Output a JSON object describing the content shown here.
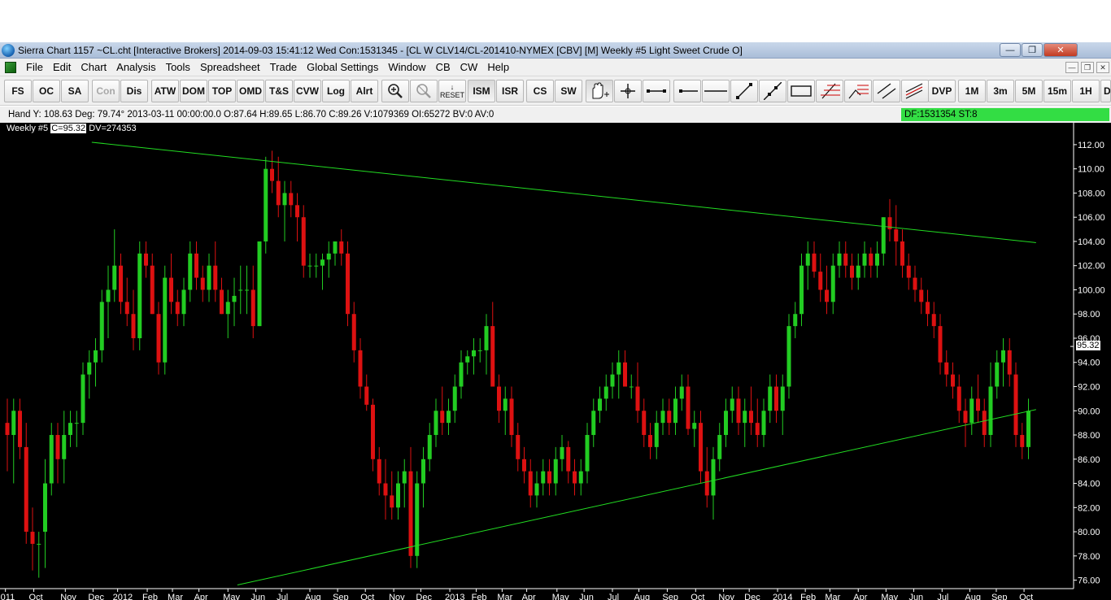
{
  "window": {
    "title": "Sierra Chart 1157 ~CL.cht [Interactive Brokers] 2014-09-03  15:41:12 Wed  Con:1531345 - [CL W  CLV14/CL-201410-NYMEX [CBV] [M]  Weekly  #5  Light Sweet Crude O]",
    "minimize": "—",
    "maximize": "❐",
    "close": "✕"
  },
  "menu": {
    "items": [
      "File",
      "Edit",
      "Chart",
      "Analysis",
      "Tools",
      "Spreadsheet",
      "Trade",
      "Global Settings",
      "Window",
      "CB",
      "CW",
      "Help"
    ],
    "mdi_minimize": "—",
    "mdi_restore": "❐",
    "mdi_close": "✕"
  },
  "toolbar": {
    "buttons": [
      "FS",
      "OC",
      "SA",
      "Con",
      "Dis",
      "ATW",
      "DOM",
      "TOP",
      "OMD",
      "T&S",
      "CVW",
      "Log",
      "Alrt"
    ],
    "reset": "RESET",
    "buttons2": [
      "ISM",
      "ISR",
      "CS",
      "SW"
    ],
    "tools": [
      "hand-tool-icon",
      "crosshair-icon",
      "ruler-icon",
      "ray-icon",
      "horizontal-line-icon",
      "line-icon",
      "extended-line-icon",
      "rectangle-icon",
      "fib-icon",
      "fib-extension-icon",
      "parallel-lines-icon",
      "regression-icon"
    ],
    "buttons3": [
      "DVP",
      "1M",
      "3m",
      "5M",
      "15m",
      "1H",
      "D"
    ]
  },
  "status": {
    "text": "Hand Y: 108.63  Deg: 79.74°  2013-03-11  00:00:00.0  O:87.64  H:89.65  L:86.70  C:89.26  V:1079369  OI:65272  BV:0  AV:0",
    "df": "DF:1531354  ST:8"
  },
  "chart_header": {
    "study": "Weekly #5",
    "close_label": "C=95.32",
    "dv": "DV=274353"
  },
  "price_label": "95.32",
  "colors": {
    "up": "#22cc22",
    "down": "#dd1111",
    "trendline": "#22dd22",
    "background": "#000000",
    "axis_text": "#ffffff"
  },
  "chart_data": {
    "type": "candlestick",
    "title": "",
    "ylim": [
      75.5,
      112.6
    ],
    "y_ticks": [
      76,
      78,
      80,
      82,
      84,
      86,
      88,
      90,
      92,
      94,
      96,
      98,
      100,
      102,
      104,
      106,
      108,
      110,
      112
    ],
    "y_tick_labels": [
      "76.00",
      "78.00",
      "80.00",
      "82.00",
      "84.00",
      "86.00",
      "88.00",
      "90.00",
      "92.00",
      "94.00",
      "96.00",
      "98.00",
      "100.00",
      "102.00",
      "104.00",
      "106.00",
      "108.00",
      "110.00",
      "112.00"
    ],
    "x_labels": [
      {
        "i": -0.3,
        "t": "011"
      },
      {
        "i": 4.2,
        "t": "Oct"
      },
      {
        "i": 9.2,
        "t": "Nov"
      },
      {
        "i": 13.6,
        "t": "Dec"
      },
      {
        "i": 17.5,
        "t": "2012"
      },
      {
        "i": 22.2,
        "t": "Feb"
      },
      {
        "i": 26.2,
        "t": "Mar"
      },
      {
        "i": 30.4,
        "t": "Apr"
      },
      {
        "i": 35.0,
        "t": "May"
      },
      {
        "i": 39.4,
        "t": "Jun"
      },
      {
        "i": 43.5,
        "t": "Jul"
      },
      {
        "i": 48.0,
        "t": "Aug"
      },
      {
        "i": 52.4,
        "t": "Sep"
      },
      {
        "i": 56.8,
        "t": "Oct"
      },
      {
        "i": 61.3,
        "t": "Nov"
      },
      {
        "i": 65.6,
        "t": "Dec"
      },
      {
        "i": 70.2,
        "t": "2013"
      },
      {
        "i": 74.4,
        "t": "Feb"
      },
      {
        "i": 78.5,
        "t": "Mar"
      },
      {
        "i": 82.4,
        "t": "Apr"
      },
      {
        "i": 87.2,
        "t": "May"
      },
      {
        "i": 91.5,
        "t": "Jun"
      },
      {
        "i": 96.0,
        "t": "Jul"
      },
      {
        "i": 100.2,
        "t": "Aug"
      },
      {
        "i": 104.7,
        "t": "Sep"
      },
      {
        "i": 109.2,
        "t": "Oct"
      },
      {
        "i": 113.6,
        "t": "Nov"
      },
      {
        "i": 117.7,
        "t": "Dec"
      },
      {
        "i": 122.2,
        "t": "2014"
      },
      {
        "i": 126.6,
        "t": "Feb"
      },
      {
        "i": 130.5,
        "t": "Mar"
      },
      {
        "i": 135.0,
        "t": "Apr"
      },
      {
        "i": 139.4,
        "t": "May"
      },
      {
        "i": 143.8,
        "t": "Jun"
      },
      {
        "i": 148.3,
        "t": "Jul"
      },
      {
        "i": 152.7,
        "t": "Aug"
      },
      {
        "i": 156.9,
        "t": "Sep"
      },
      {
        "i": 161.3,
        "t": "Oct"
      }
    ],
    "trendlines": [
      {
        "i1": 13.4,
        "v1": 112.2,
        "i2": 163.2,
        "v2": 103.9
      },
      {
        "i1": 36.5,
        "v1": 75.6,
        "i2": 163.2,
        "v2": 90.1
      }
    ],
    "ohlc": [
      [
        89,
        91,
        85,
        88
      ],
      [
        88,
        91,
        84,
        90
      ],
      [
        90,
        91,
        86,
        87
      ],
      [
        87,
        89,
        79,
        80
      ],
      [
        80,
        82,
        76.8,
        79
      ],
      [
        79,
        80,
        76.2,
        79
      ],
      [
        80,
        86,
        77,
        84
      ],
      [
        84,
        89,
        83,
        88
      ],
      [
        88,
        89,
        84,
        86
      ],
      [
        86,
        90,
        84,
        88
      ],
      [
        88,
        90,
        87,
        89
      ],
      [
        89,
        90,
        87,
        89
      ],
      [
        89,
        94,
        88,
        93
      ],
      [
        93,
        95,
        91,
        94
      ],
      [
        94,
        96,
        92,
        95
      ],
      [
        95,
        100,
        94,
        99
      ],
      [
        99,
        102,
        96,
        100
      ],
      [
        100,
        105,
        99,
        102
      ],
      [
        102,
        103,
        98,
        99
      ],
      [
        99,
        101,
        97,
        98
      ],
      [
        98,
        100,
        95,
        96
      ],
      [
        96,
        104,
        95,
        103
      ],
      [
        103,
        104,
        101,
        102
      ],
      [
        102,
        103,
        98,
        98
      ],
      [
        98,
        99,
        93,
        94
      ],
      [
        94,
        102,
        93,
        101
      ],
      [
        101,
        103,
        98,
        99
      ],
      [
        99,
        100,
        97,
        98
      ],
      [
        98,
        101,
        97,
        100
      ],
      [
        100,
        104,
        99,
        103
      ],
      [
        103,
        104,
        100,
        101
      ],
      [
        101,
        102,
        99,
        100
      ],
      [
        100,
        103,
        99,
        102
      ],
      [
        102,
        104,
        99,
        100
      ],
      [
        100,
        101,
        98,
        98
      ],
      [
        98,
        100,
        96,
        99
      ],
      [
        99,
        101,
        97,
        99.5
      ],
      [
        100,
        102,
        98,
        100
      ],
      [
        100,
        102,
        98,
        100
      ],
      [
        100,
        102,
        96,
        97
      ],
      [
        97,
        104,
        97,
        104
      ],
      [
        104,
        111,
        103,
        110
      ],
      [
        110,
        111.5,
        108,
        109
      ],
      [
        109,
        111,
        106,
        107
      ],
      [
        107,
        109,
        104,
        108
      ],
      [
        108,
        109,
        106,
        107
      ],
      [
        107,
        108,
        104,
        106
      ],
      [
        106,
        107,
        101,
        102
      ],
      [
        102,
        103,
        101,
        102
      ],
      [
        102,
        103,
        101,
        102
      ],
      [
        102,
        103,
        100,
        102.5
      ],
      [
        102.5,
        104,
        101,
        103
      ],
      [
        103,
        104,
        102,
        104
      ],
      [
        104,
        105,
        102,
        103
      ],
      [
        103,
        104,
        97,
        98
      ],
      [
        98,
        99,
        94,
        95
      ],
      [
        95,
        96,
        91,
        92
      ],
      [
        92,
        93,
        90,
        90.5
      ],
      [
        90.5,
        91,
        85,
        86
      ],
      [
        86,
        87,
        83,
        84
      ],
      [
        84,
        86,
        81,
        83
      ],
      [
        83,
        85,
        81,
        82
      ],
      [
        82,
        85,
        81,
        84
      ],
      [
        84,
        86,
        82,
        85
      ],
      [
        85,
        87,
        77,
        78
      ],
      [
        78,
        85,
        77,
        84
      ],
      [
        84,
        87,
        82,
        86
      ],
      [
        86,
        89,
        85,
        88
      ],
      [
        88,
        91,
        87,
        90
      ],
      [
        90,
        92,
        88,
        89
      ],
      [
        89,
        91,
        88,
        90
      ],
      [
        90,
        93,
        89,
        92
      ],
      [
        92,
        95,
        91,
        94
      ],
      [
        94,
        95,
        93,
        94.5
      ],
      [
        94.5,
        96,
        93,
        95
      ],
      [
        95,
        96,
        94,
        95
      ],
      [
        95,
        98,
        93,
        97
      ],
      [
        97,
        99,
        92,
        92
      ],
      [
        92,
        93,
        89,
        90
      ],
      [
        90,
        92,
        88,
        91
      ],
      [
        91,
        92,
        87,
        88
      ],
      [
        88,
        89,
        85,
        86
      ],
      [
        86,
        87,
        84,
        85
      ],
      [
        85,
        86,
        82,
        83
      ],
      [
        83,
        85,
        82,
        84
      ],
      [
        84,
        86,
        83,
        85
      ],
      [
        85,
        86,
        83,
        84
      ],
      [
        84,
        87,
        83,
        86
      ],
      [
        86,
        88,
        85,
        87
      ],
      [
        87,
        87.5,
        84,
        85
      ],
      [
        85,
        86,
        83,
        84
      ],
      [
        84,
        86,
        83,
        85
      ],
      [
        85,
        89,
        84,
        88
      ],
      [
        88,
        91,
        87,
        90
      ],
      [
        90,
        92,
        89,
        91
      ],
      [
        91,
        93,
        90,
        92
      ],
      [
        92,
        94,
        91,
        93
      ],
      [
        93,
        95,
        91,
        94
      ],
      [
        94,
        95,
        92,
        92
      ],
      [
        92,
        93,
        91,
        92
      ],
      [
        92,
        94,
        89,
        90
      ],
      [
        90,
        91,
        87,
        88
      ],
      [
        88,
        89,
        86,
        87
      ],
      [
        87,
        90,
        86,
        89
      ],
      [
        89,
        91,
        88,
        90
      ],
      [
        90,
        91,
        88,
        89
      ],
      [
        89,
        92,
        88,
        91
      ],
      [
        91,
        93,
        90,
        92
      ],
      [
        92,
        93,
        88,
        88.5
      ],
      [
        88.5,
        90,
        87,
        89
      ],
      [
        89,
        90,
        84,
        85
      ],
      [
        85,
        87,
        82,
        83
      ],
      [
        83,
        87,
        81,
        86
      ],
      [
        86,
        89,
        85,
        88
      ],
      [
        88,
        91,
        87,
        90
      ],
      [
        90,
        92,
        89,
        91
      ],
      [
        91,
        92,
        88,
        89
      ],
      [
        89,
        91,
        87,
        90
      ],
      [
        90,
        92,
        88,
        89
      ],
      [
        89,
        91,
        87,
        88
      ],
      [
        88,
        91,
        87,
        90
      ],
      [
        90,
        93,
        89,
        92
      ],
      [
        92,
        93,
        89,
        90
      ],
      [
        90,
        93,
        88,
        92
      ],
      [
        92,
        98,
        91,
        97
      ],
      [
        97,
        99,
        96,
        98
      ],
      [
        98,
        103,
        97,
        102
      ],
      [
        102,
        104,
        100,
        103
      ],
      [
        103,
        104,
        101,
        101.5
      ],
      [
        101.5,
        103,
        99,
        100
      ],
      [
        100,
        102,
        98,
        99
      ],
      [
        99,
        103,
        98,
        102
      ],
      [
        102,
        104,
        101,
        103
      ],
      [
        103,
        104,
        101,
        102
      ],
      [
        102,
        103,
        100,
        101
      ],
      [
        101,
        103,
        100,
        102
      ],
      [
        102,
        104,
        101,
        103
      ],
      [
        103,
        103.5,
        101,
        102
      ],
      [
        102,
        104,
        101,
        103
      ],
      [
        103,
        106,
        102,
        106
      ],
      [
        106,
        107.5,
        104,
        105
      ],
      [
        105,
        107,
        102,
        104
      ],
      [
        104,
        105,
        101,
        102
      ],
      [
        102,
        103,
        100,
        101
      ],
      [
        101,
        102,
        99,
        100
      ],
      [
        100,
        101,
        98,
        99
      ],
      [
        99,
        100,
        97,
        98
      ],
      [
        98,
        99,
        96,
        97
      ],
      [
        97,
        98,
        93,
        94
      ],
      [
        94,
        95,
        92,
        93
      ],
      [
        93,
        94,
        91,
        92
      ],
      [
        92,
        93,
        89,
        90
      ],
      [
        90,
        91,
        87,
        89
      ],
      [
        89,
        92,
        88,
        91
      ],
      [
        91,
        93,
        89,
        90
      ],
      [
        90,
        91,
        87,
        88
      ],
      [
        88,
        94,
        87,
        92
      ],
      [
        92,
        95,
        91,
        94
      ],
      [
        94,
        96,
        92,
        95
      ],
      [
        95,
        96,
        92,
        93
      ],
      [
        93,
        94,
        87,
        88
      ],
      [
        88,
        89,
        86,
        87
      ],
      [
        87,
        91,
        86,
        90
      ]
    ]
  }
}
